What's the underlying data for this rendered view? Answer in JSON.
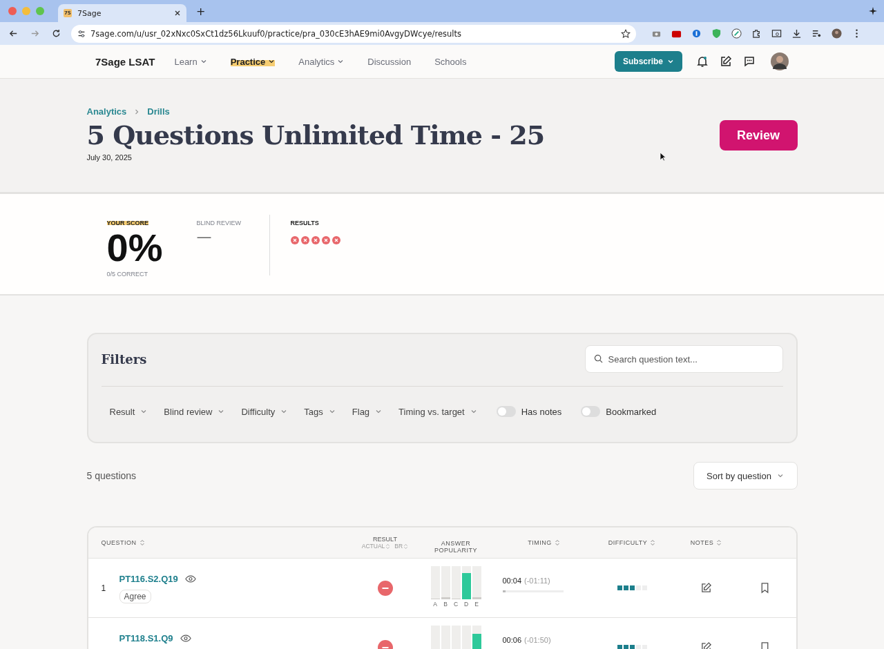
{
  "browser": {
    "tab_favicon": "7S",
    "tab_title": "7Sage",
    "new_tab": "+",
    "url": "7sage.com/u/usr_02xNxc0SxCt1dz56Lkuuf0/practice/pra_030cE3hAE9mi0AvgyDWcye/results"
  },
  "nav": {
    "logo": "7Sage LSAT",
    "items": [
      {
        "label": "Learn",
        "dropdown": true,
        "selected": false
      },
      {
        "label": "Practice",
        "dropdown": true,
        "selected": true
      },
      {
        "label": "Analytics",
        "dropdown": true,
        "selected": false
      },
      {
        "label": "Discussion",
        "dropdown": false,
        "selected": false
      },
      {
        "label": "Schools",
        "dropdown": false,
        "selected": false
      }
    ],
    "subscribe": "Subscribe"
  },
  "header": {
    "breadcrumbs": [
      "Analytics",
      "Drills"
    ],
    "title": "5 Questions Unlimited Time - 25",
    "date": "July 30, 2025",
    "review_button": "Review"
  },
  "score": {
    "label": "YOUR SCORE",
    "value": "0%",
    "caption": "0/5 CORRECT",
    "blind_review_label": "BLIND REVIEW",
    "blind_review_value": "—",
    "results_label": "RESULTS",
    "results": [
      {
        "correct": false
      },
      {
        "correct": false
      },
      {
        "correct": false
      },
      {
        "correct": false
      },
      {
        "correct": false
      }
    ]
  },
  "filters": {
    "title": "Filters",
    "search_placeholder": "Search question text...",
    "dropdowns": [
      "Result",
      "Blind review",
      "Difficulty",
      "Tags",
      "Flag",
      "Timing vs. target"
    ],
    "toggles": [
      {
        "label": "Has notes",
        "on": false
      },
      {
        "label": "Bookmarked",
        "on": false
      }
    ]
  },
  "count": "5 questions",
  "sort": "Sort by question",
  "table": {
    "columns": {
      "question": "QUESTION",
      "result": "RESULT",
      "actual": "ACTUAL",
      "br": "BR",
      "popularity": "ANSWER POPULARITY",
      "timing": "TIMING",
      "difficulty": "DIFFICULTY",
      "notes": "NOTES"
    },
    "rows": [
      {
        "number": "1",
        "question": "PT116.S2.Q19",
        "tag": "Agree",
        "correct": false,
        "popularity": [
          {
            "label": "A",
            "level": 0.02,
            "correct": false
          },
          {
            "label": "B",
            "level": 0.06,
            "correct": false
          },
          {
            "label": "C",
            "level": 0.01,
            "correct": false
          },
          {
            "label": "D",
            "level": 0.8,
            "correct": true
          },
          {
            "label": "E",
            "level": 0.06,
            "correct": false
          }
        ],
        "timing": {
          "time": "00:04",
          "delta": "(-01:11)",
          "level": 0.05
        },
        "difficulty": {
          "level": 0.6
        }
      },
      {
        "question": "PT118.S1.Q9",
        "correct": false,
        "popularity": [
          {
            "level": 0.75,
            "correct": true
          }
        ],
        "timing": {
          "time": "00:06",
          "delta": "(-01:50)"
        },
        "difficulty": {
          "level": 0.6
        }
      }
    ]
  }
}
